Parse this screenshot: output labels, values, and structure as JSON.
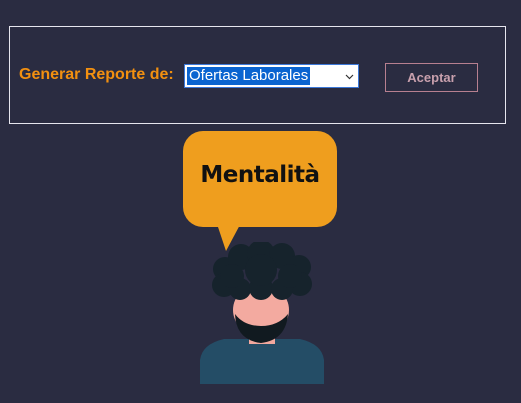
{
  "report": {
    "label": "Generar Reporte de:",
    "select": {
      "selected": "Ofertas Laborales"
    },
    "accept_button": "Aceptar"
  },
  "illustration": {
    "bubble_text": "Mentalità"
  },
  "colors": {
    "background": "#2a2c41",
    "label_orange": "#f29010",
    "bubble_orange": "#ef9e1e",
    "select_highlight": "#0a64d0",
    "button_border": "#b78090"
  }
}
